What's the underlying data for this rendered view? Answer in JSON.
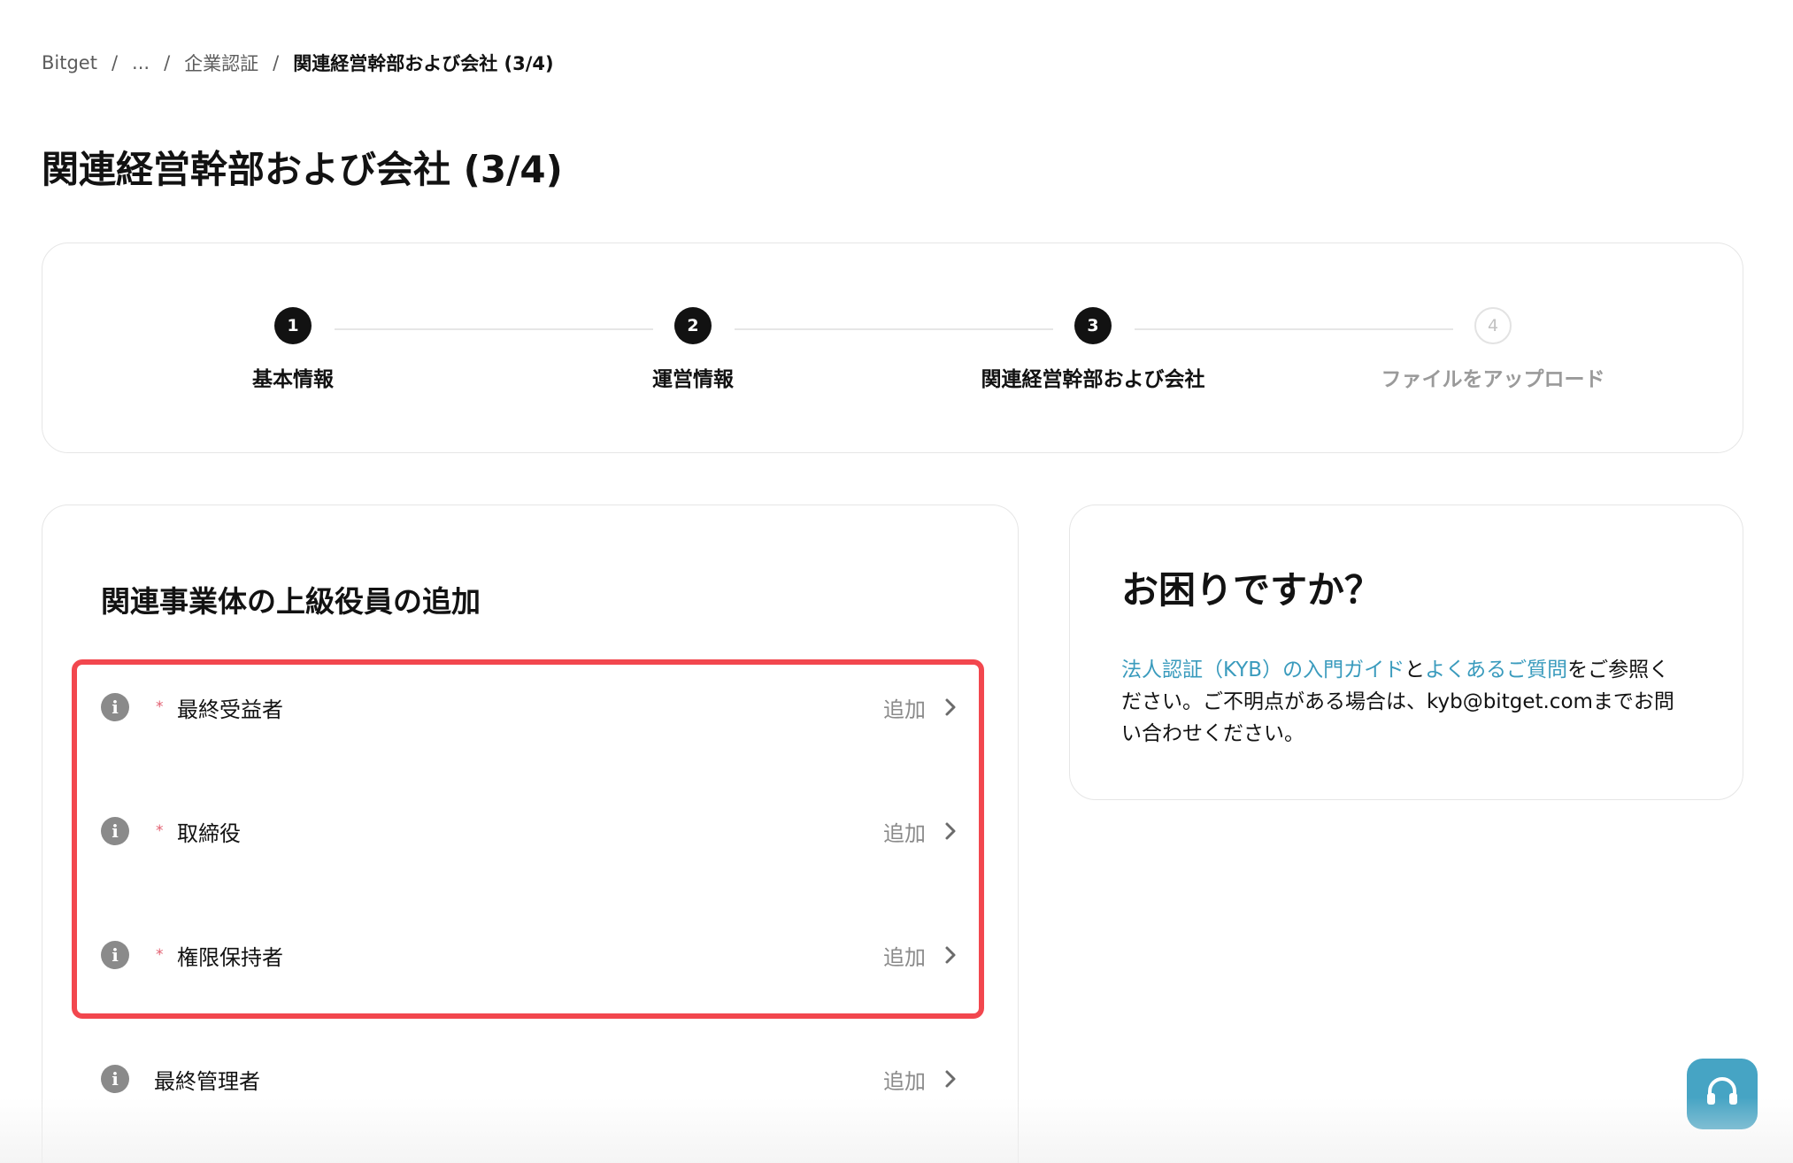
{
  "breadcrumb": {
    "items": [
      "Bitget",
      "...",
      "企業認証"
    ],
    "current": "関連経営幹部および会社 (3/4)",
    "separator": "/"
  },
  "page_title": "関連経営幹部および会社 (3/4)",
  "stepper": {
    "steps": [
      {
        "number": "1",
        "label": "基本情報",
        "state": "done"
      },
      {
        "number": "2",
        "label": "運営情報",
        "state": "done"
      },
      {
        "number": "3",
        "label": "関連経営幹部および会社",
        "state": "active"
      },
      {
        "number": "4",
        "label": "ファイルをアップロード",
        "state": "pending"
      }
    ]
  },
  "executives": {
    "title": "関連事業体の上級役員の追加",
    "required_mark": "*",
    "rows": [
      {
        "label": "最終受益者",
        "required": true,
        "action": "追加"
      },
      {
        "label": "取締役",
        "required": true,
        "action": "追加"
      },
      {
        "label": "権限保持者",
        "required": true,
        "action": "追加"
      },
      {
        "label": "最終管理者",
        "required": false,
        "action": "追加"
      }
    ]
  },
  "help": {
    "title": "お困りですか？",
    "link1": "法人認証（KYB）の入門ガイド",
    "conj": "と",
    "link2": "よくあるご質問",
    "text_rest": "をご参照ください。ご不明点がある場合は、",
    "email": "kyb@bitget.com",
    "text_end": "までお問い合わせください。"
  },
  "colors": {
    "accent_link": "#3a9bbd",
    "highlight_border": "#f2474e",
    "required_star": "#e26071",
    "support_button": "#46a4c4"
  },
  "icons": {
    "info": "info-icon",
    "chevron": "chevron-right-icon",
    "support": "headset-icon"
  }
}
